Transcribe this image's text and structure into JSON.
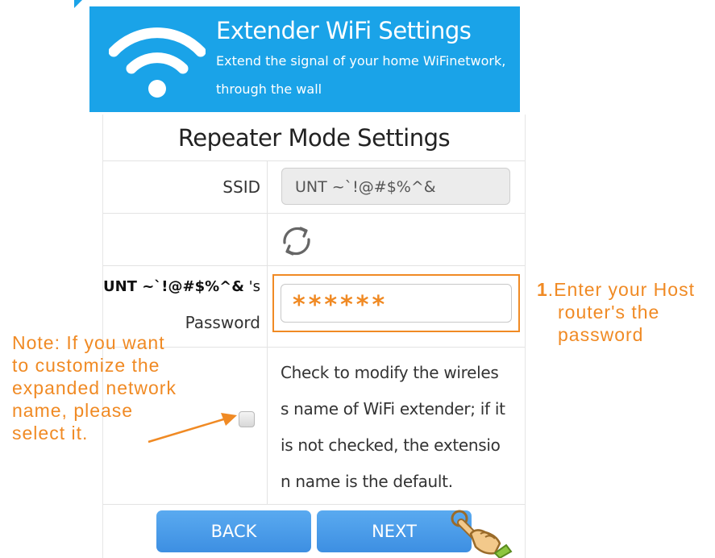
{
  "banner": {
    "title": "Extender WiFi Settings",
    "subtitle_line1": "Extend the signal of your home WiFinetwork,",
    "subtitle_line2": "through the wall",
    "icon": "wifi-icon",
    "color": "#1aa3e8"
  },
  "form": {
    "title": "Repeater Mode Settings",
    "ssid_label": "SSID",
    "ssid_value": "UNT ~`!@#$%^&",
    "refresh_icon": "refresh-icon",
    "password_ssid": "UNT ~`!@#$%^&",
    "password_suffix": " 's",
    "password_label": "Password",
    "password_value": "******",
    "checkbox_checked": false,
    "checkbox_desc_lines": [
      "Check to modify the wireles",
      "s name of WiFi extender; if it",
      "is not checked, the extensio",
      "n name is the default."
    ],
    "back_label": "BACK",
    "next_label": "NEXT",
    "button_color": "#4a9be8"
  },
  "annotations": {
    "step_number": "1",
    "step_text_line1": ".Enter your Host",
    "step_text_line2": "router's the",
    "step_text_line3": "password",
    "note_lines": [
      "Note: If you want",
      "to customize the",
      "expanded network",
      "name, please",
      "select it."
    ],
    "accent_color": "#f08a24"
  }
}
